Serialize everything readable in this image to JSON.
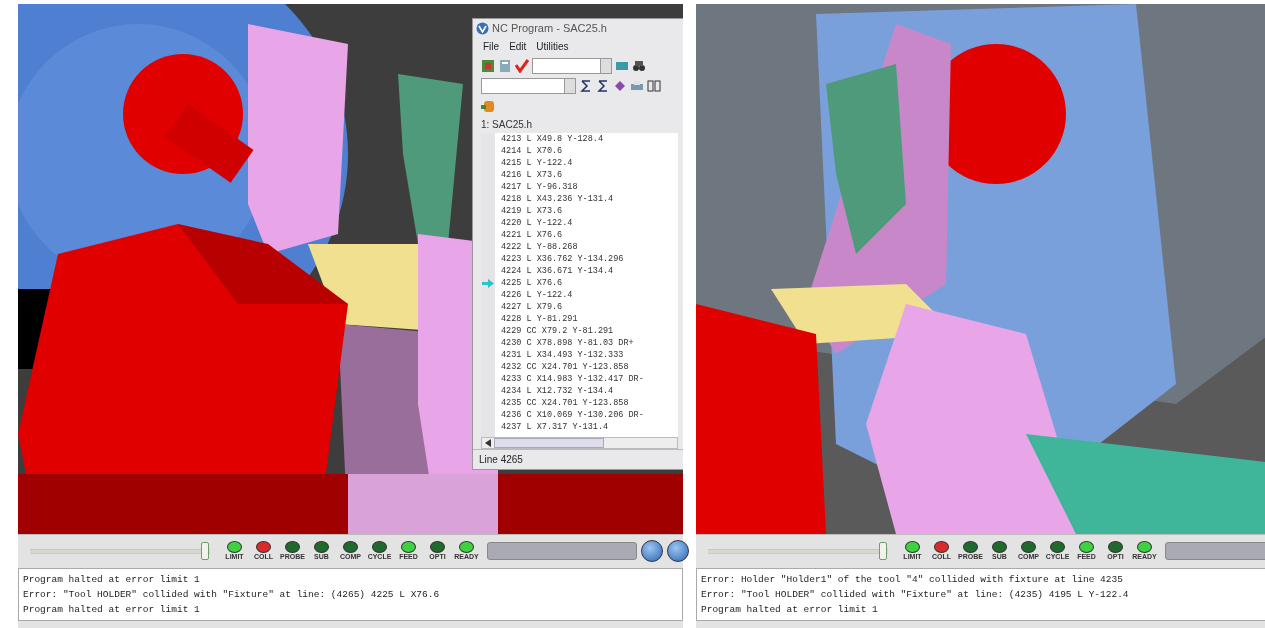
{
  "panels": [
    {
      "nc_program": {
        "title": "NC Program - SAC25.h",
        "menu": [
          "File",
          "Edit",
          "Utilities"
        ],
        "file_tab": "1: SAC25.h",
        "lines": [
          {
            "text": "4213 L X49.8 Y-128.4",
            "selected": false
          },
          {
            "text": "4214 L X70.6",
            "selected": false
          },
          {
            "text": "4215 L Y-122.4",
            "selected": false
          },
          {
            "text": "4216 L X73.6",
            "selected": false
          },
          {
            "text": "4217 L Y-96.318",
            "selected": false
          },
          {
            "text": "4218 L X43.236 Y-131.4",
            "selected": false
          },
          {
            "text": "4219 L X73.6",
            "selected": false
          },
          {
            "text": "4220 L Y-122.4",
            "selected": false
          },
          {
            "text": "4221 L X76.6",
            "selected": false
          },
          {
            "text": "4222 L Y-88.268",
            "selected": false
          },
          {
            "text": "4223 L X36.762 Y-134.296",
            "selected": false
          },
          {
            "text": "4224 L X36.671 Y-134.4",
            "selected": false
          },
          {
            "text": "4225 L X76.6",
            "selected": true
          },
          {
            "text": "4226 L Y-122.4",
            "selected": false
          },
          {
            "text": "4227 L X79.6",
            "selected": false
          },
          {
            "text": "4228 L Y-81.291",
            "selected": false
          },
          {
            "text": "4229 CC X79.2 Y-81.291",
            "selected": false
          },
          {
            "text": "4230 C X78.898 Y-81.03 DR+",
            "selected": false
          },
          {
            "text": "4231 L X34.493 Y-132.333",
            "selected": false
          },
          {
            "text": "4232 CC X24.701 Y-123.858",
            "selected": false
          },
          {
            "text": "4233 C X14.983 Y-132.417 DR-",
            "selected": false
          },
          {
            "text": "4234 L X12.732 Y-134.4",
            "selected": false
          },
          {
            "text": "4235 CC X24.701 Y-123.858",
            "selected": false
          },
          {
            "text": "4236 C X10.069 Y-130.206 DR-",
            "selected": false
          },
          {
            "text": "4237 L X7.317 Y-131.4",
            "selected": false
          }
        ],
        "status": "Line 4265"
      },
      "slider": {
        "level": 0.97
      },
      "lights": [
        {
          "label": "LIMIT",
          "color": "#3fd13f"
        },
        {
          "label": "COLL",
          "color": "#d92b2b"
        },
        {
          "label": "PROBE",
          "color": "#1f6a2c"
        },
        {
          "label": "SUB",
          "color": "#1f6a2c"
        },
        {
          "label": "COMP",
          "color": "#1f6a2c"
        },
        {
          "label": "CYCLE",
          "color": "#1f6a2c"
        },
        {
          "label": "FEED",
          "color": "#3fd13f"
        },
        {
          "label": "OPTI",
          "color": "#1f6a2c"
        },
        {
          "label": "READY",
          "color": "#3fd13f"
        }
      ],
      "nav_buttons": true,
      "progress": {
        "level": 0
      },
      "messages": [
        "Program halted at error limit 1",
        "Error: \"Tool HOLDER\" collided with \"Fixture\" at line: (4265) 4225 L X76.6",
        "Program halted at error limit 1"
      ]
    },
    {
      "slider": {
        "level": 0.97
      },
      "progress": {
        "level": 0
      },
      "lights": [
        {
          "label": "LIMIT",
          "color": "#3fd13f"
        },
        {
          "label": "COLL",
          "color": "#d92b2b"
        },
        {
          "label": "PROBE",
          "color": "#1f6a2c"
        },
        {
          "label": "SUB",
          "color": "#1f6a2c"
        },
        {
          "label": "COMP",
          "color": "#1f6a2c"
        },
        {
          "label": "CYCLE",
          "color": "#1f6a2c"
        },
        {
          "label": "FEED",
          "color": "#3fd13f"
        },
        {
          "label": "OPTI",
          "color": "#1f6a2c"
        },
        {
          "label": "READY",
          "color": "#3fd13f"
        }
      ],
      "messages": [
        "Error: Holder \"Holder1\" of the tool \"4\" collided with fixture at line 4235",
        "Error: \"Tool HOLDER\" collided with \"Fixture\" at line: (4235) 4195 L Y-122.4",
        "Program halted at error limit 1"
      ]
    }
  ]
}
